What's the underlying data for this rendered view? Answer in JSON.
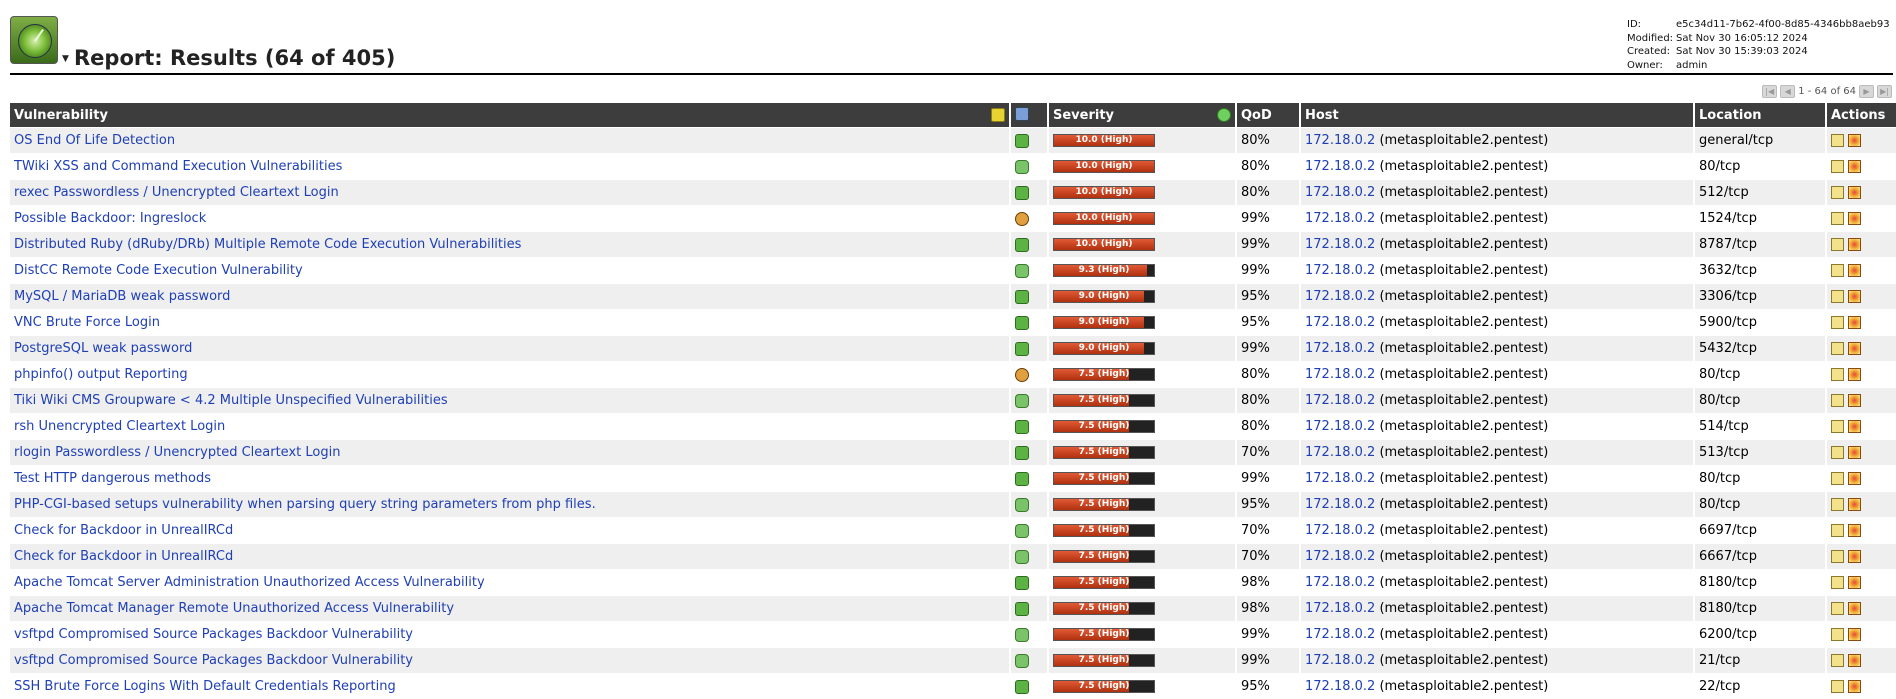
{
  "header": {
    "title": "Report: Results (64 of 405)",
    "meta": [
      {
        "key": "ID:",
        "value": "e5c34d11-7b62-4f00-8d85-4346bb8aeb93"
      },
      {
        "key": "Modified:",
        "value": "Sat Nov 30 16:05:12 2024"
      },
      {
        "key": "Created:",
        "value": "Sat Nov 30 15:39:03 2024"
      },
      {
        "key": "Owner:",
        "value": "admin"
      }
    ]
  },
  "pager": {
    "text": "1 - 64 of 64"
  },
  "columns": {
    "vulnerability": "Vulnerability",
    "severity": "Severity",
    "qod": "QoD",
    "host": "Host",
    "location": "Location",
    "actions": "Actions"
  },
  "colors": {
    "header_bg": "#3d3d3d",
    "link": "#1f3fb5",
    "severity_high": "#c8401f"
  },
  "rows": [
    {
      "name": "OS End Of Life Detection",
      "solution": "vendorfix",
      "severity": 10.0,
      "severity_label": "10.0 (High)",
      "qod": "80%",
      "ip": "172.18.0.2",
      "hostname": "(metasploitable2.pentest)",
      "location": "general/tcp"
    },
    {
      "name": "TWiki XSS and Command Execution Vulnerabilities",
      "solution": "workaround",
      "severity": 10.0,
      "severity_label": "10.0 (High)",
      "qod": "80%",
      "ip": "172.18.0.2",
      "hostname": "(metasploitable2.pentest)",
      "location": "80/tcp"
    },
    {
      "name": "rexec Passwordless / Unencrypted Cleartext Login",
      "solution": "vendorfix",
      "severity": 10.0,
      "severity_label": "10.0 (High)",
      "qod": "80%",
      "ip": "172.18.0.2",
      "hostname": "(metasploitable2.pentest)",
      "location": "512/tcp"
    },
    {
      "name": "Possible Backdoor: Ingreslock",
      "solution": "mitigation",
      "severity": 10.0,
      "severity_label": "10.0 (High)",
      "qod": "99%",
      "ip": "172.18.0.2",
      "hostname": "(metasploitable2.pentest)",
      "location": "1524/tcp"
    },
    {
      "name": "Distributed Ruby (dRuby/DRb) Multiple Remote Code Execution Vulnerabilities",
      "solution": "vendorfix",
      "severity": 10.0,
      "severity_label": "10.0 (High)",
      "qod": "99%",
      "ip": "172.18.0.2",
      "hostname": "(metasploitable2.pentest)",
      "location": "8787/tcp"
    },
    {
      "name": "DistCC Remote Code Execution Vulnerability",
      "solution": "workaround",
      "severity": 9.3,
      "severity_label": "9.3 (High)",
      "qod": "99%",
      "ip": "172.18.0.2",
      "hostname": "(metasploitable2.pentest)",
      "location": "3632/tcp"
    },
    {
      "name": "MySQL / MariaDB weak password",
      "solution": "vendorfix",
      "severity": 9.0,
      "severity_label": "9.0 (High)",
      "qod": "95%",
      "ip": "172.18.0.2",
      "hostname": "(metasploitable2.pentest)",
      "location": "3306/tcp"
    },
    {
      "name": "VNC Brute Force Login",
      "solution": "vendorfix",
      "severity": 9.0,
      "severity_label": "9.0 (High)",
      "qod": "95%",
      "ip": "172.18.0.2",
      "hostname": "(metasploitable2.pentest)",
      "location": "5900/tcp"
    },
    {
      "name": "PostgreSQL weak password",
      "solution": "vendorfix",
      "severity": 9.0,
      "severity_label": "9.0 (High)",
      "qod": "99%",
      "ip": "172.18.0.2",
      "hostname": "(metasploitable2.pentest)",
      "location": "5432/tcp"
    },
    {
      "name": "phpinfo() output Reporting",
      "solution": "mitigation",
      "severity": 7.5,
      "severity_label": "7.5 (High)",
      "qod": "80%",
      "ip": "172.18.0.2",
      "hostname": "(metasploitable2.pentest)",
      "location": "80/tcp"
    },
    {
      "name": "Tiki Wiki CMS Groupware < 4.2 Multiple Unspecified Vulnerabilities",
      "solution": "workaround",
      "severity": 7.5,
      "severity_label": "7.5 (High)",
      "qod": "80%",
      "ip": "172.18.0.2",
      "hostname": "(metasploitable2.pentest)",
      "location": "80/tcp"
    },
    {
      "name": "rsh Unencrypted Cleartext Login",
      "solution": "vendorfix",
      "severity": 7.5,
      "severity_label": "7.5 (High)",
      "qod": "80%",
      "ip": "172.18.0.2",
      "hostname": "(metasploitable2.pentest)",
      "location": "514/tcp"
    },
    {
      "name": "rlogin Passwordless / Unencrypted Cleartext Login",
      "solution": "vendorfix",
      "severity": 7.5,
      "severity_label": "7.5 (High)",
      "qod": "70%",
      "ip": "172.18.0.2",
      "hostname": "(metasploitable2.pentest)",
      "location": "513/tcp"
    },
    {
      "name": "Test HTTP dangerous methods",
      "solution": "vendorfix",
      "severity": 7.5,
      "severity_label": "7.5 (High)",
      "qod": "99%",
      "ip": "172.18.0.2",
      "hostname": "(metasploitable2.pentest)",
      "location": "80/tcp"
    },
    {
      "name": "PHP-CGI-based setups vulnerability when parsing query string parameters from php files.",
      "solution": "workaround",
      "severity": 7.5,
      "severity_label": "7.5 (High)",
      "qod": "95%",
      "ip": "172.18.0.2",
      "hostname": "(metasploitable2.pentest)",
      "location": "80/tcp"
    },
    {
      "name": "Check for Backdoor in UnrealIRCd",
      "solution": "workaround",
      "severity": 7.5,
      "severity_label": "7.5 (High)",
      "qod": "70%",
      "ip": "172.18.0.2",
      "hostname": "(metasploitable2.pentest)",
      "location": "6697/tcp"
    },
    {
      "name": "Check for Backdoor in UnrealIRCd",
      "solution": "workaround",
      "severity": 7.5,
      "severity_label": "7.5 (High)",
      "qod": "70%",
      "ip": "172.18.0.2",
      "hostname": "(metasploitable2.pentest)",
      "location": "6667/tcp"
    },
    {
      "name": "Apache Tomcat Server Administration Unauthorized Access Vulnerability",
      "solution": "vendorfix",
      "severity": 7.5,
      "severity_label": "7.5 (High)",
      "qod": "98%",
      "ip": "172.18.0.2",
      "hostname": "(metasploitable2.pentest)",
      "location": "8180/tcp"
    },
    {
      "name": "Apache Tomcat Manager Remote Unauthorized Access Vulnerability",
      "solution": "vendorfix",
      "severity": 7.5,
      "severity_label": "7.5 (High)",
      "qod": "98%",
      "ip": "172.18.0.2",
      "hostname": "(metasploitable2.pentest)",
      "location": "8180/tcp"
    },
    {
      "name": "vsftpd Compromised Source Packages Backdoor Vulnerability",
      "solution": "workaround",
      "severity": 7.5,
      "severity_label": "7.5 (High)",
      "qod": "99%",
      "ip": "172.18.0.2",
      "hostname": "(metasploitable2.pentest)",
      "location": "6200/tcp"
    },
    {
      "name": "vsftpd Compromised Source Packages Backdoor Vulnerability",
      "solution": "workaround",
      "severity": 7.5,
      "severity_label": "7.5 (High)",
      "qod": "99%",
      "ip": "172.18.0.2",
      "hostname": "(metasploitable2.pentest)",
      "location": "21/tcp"
    },
    {
      "name": "SSH Brute Force Logins With Default Credentials Reporting",
      "solution": "vendorfix",
      "severity": 7.5,
      "severity_label": "7.5 (High)",
      "qod": "95%",
      "ip": "172.18.0.2",
      "hostname": "(metasploitable2.pentest)",
      "location": "22/tcp"
    }
  ]
}
